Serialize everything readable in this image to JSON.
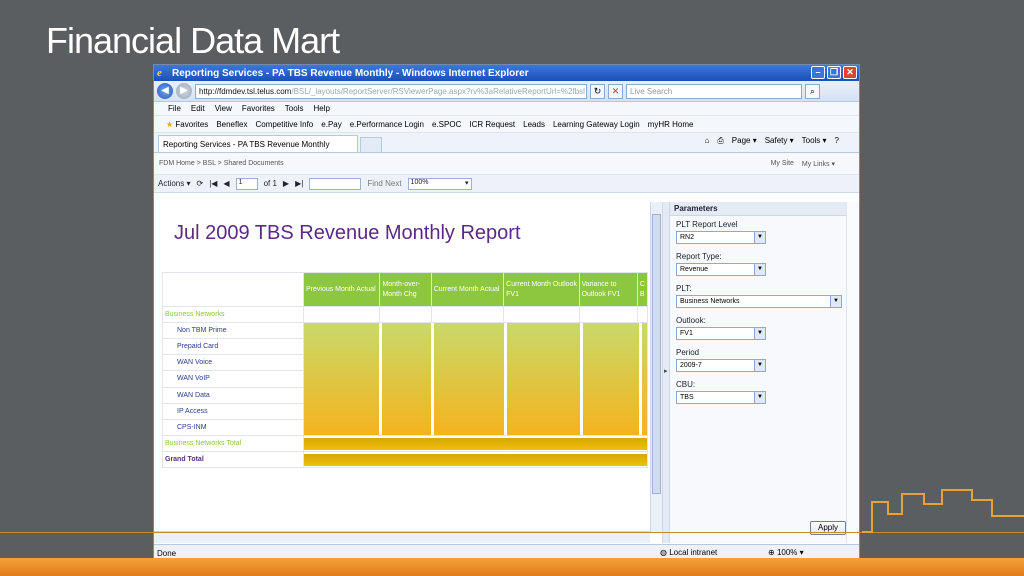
{
  "slide": {
    "title": "Financial Data Mart"
  },
  "window": {
    "title": "Reporting Services - PA TBS Revenue Monthly - Windows Internet Explorer"
  },
  "address": {
    "url_host": "http://fdmdev.tsl.telus.com",
    "url_path": "/BSL/_layouts/ReportServer/RSViewerPage.aspx?rv%3aRelativeReportUrl=%2fbsl",
    "search_placeholder": "Live Search"
  },
  "menu": [
    "File",
    "Edit",
    "View",
    "Favorites",
    "Tools",
    "Help"
  ],
  "favorites": {
    "label": "Favorites",
    "links": [
      "Beneflex",
      "Competitive Info",
      "e.Pay",
      "e.Performance Login",
      "e.SPOC",
      "ICR Request",
      "Leads",
      "Learning Gateway Login",
      "myHR Home"
    ]
  },
  "tab": {
    "label": "Reporting Services - PA TBS Revenue Monthly"
  },
  "commands": [
    "Page ▾",
    "Safety ▾",
    "Tools ▾"
  ],
  "sharepoint": {
    "breadcrumb": "FDM Home > BSL > Shared Documents",
    "my_site": "My Site",
    "my_links": "My Links ▾"
  },
  "toolbar": {
    "actions": "Actions ▾",
    "page": "1",
    "of_pages": "of 1",
    "find_next": "Find Next",
    "zoom": "100%"
  },
  "report": {
    "title": "Jul 2009 TBS Revenue Monthly Report",
    "headers": [
      "Previous Month Actual",
      "Month-over-Month Chg",
      "Current Month Actual",
      "Current Month Outlook FV1",
      "Variance to Outlook FV1",
      "C B"
    ],
    "group": "Business Networks",
    "rows": [
      "Non TBM Prime",
      "Prepaid Card",
      "WAN Voice",
      "WAN VoIP",
      "WAN Data",
      "IP Access",
      "CPS-INM"
    ],
    "group_total": "Business Networks Total",
    "grand_total": "Grand Total"
  },
  "params": {
    "header": "Parameters",
    "fields": [
      {
        "label": "PLT Report Level",
        "value": "RN2"
      },
      {
        "label": "Report Type:",
        "value": "Revenue"
      },
      {
        "label": "PLT:",
        "value": "Business Networks"
      },
      {
        "label": "Outlook:",
        "value": "FV1"
      },
      {
        "label": "Period",
        "value": "2009-7"
      },
      {
        "label": "CBU:",
        "value": "TBS"
      }
    ],
    "apply": "Apply"
  },
  "status": {
    "text": "Done",
    "zone": "Local intranet",
    "zoom": "100% ▾"
  }
}
